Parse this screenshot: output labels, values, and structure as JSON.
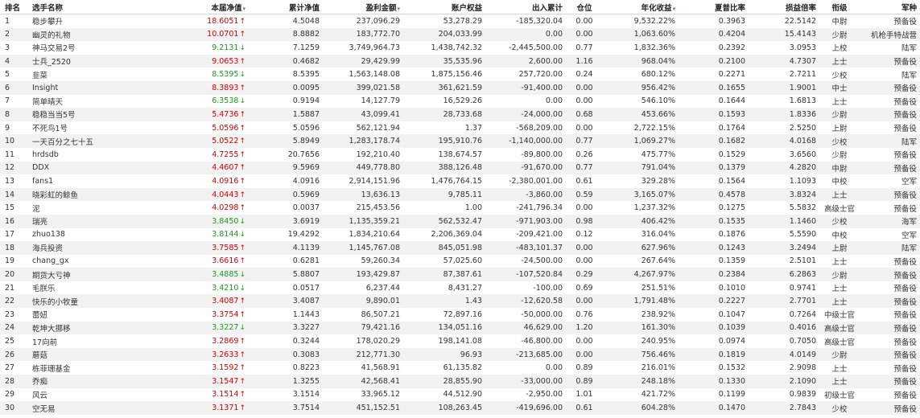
{
  "headers": {
    "rank": "排名",
    "name": "选手名称",
    "nav": "本届净值",
    "cum_nav": "累计净值",
    "profit": "盈利金额",
    "equity": "账户权益",
    "io": "出入累计",
    "position": "仓位",
    "annual": "年化收益",
    "sharpe": "夏普比率",
    "drawdown_mult": "损益倍率",
    "grade": "衔级",
    "army": "军种"
  },
  "sort_indicator": "▾",
  "colors": {
    "up": "#d40000",
    "down": "#1a9a1a"
  },
  "rows": [
    {
      "rank": "1",
      "name": "稳步攀升",
      "nav": "18.6051",
      "dir": "up",
      "cum_nav": "4.5048",
      "profit": "237,096.29",
      "equity": "53,278.29",
      "io": "-185,320.04",
      "position": "0.00",
      "annual": "9,532.22%",
      "sharpe": "0.3963",
      "ratio": "22.5142",
      "grade": "中尉",
      "army": "预备役"
    },
    {
      "rank": "2",
      "name": "幽灵的礼物",
      "nav": "10.0701",
      "dir": "up",
      "cum_nav": "8.8882",
      "profit": "183,772.70",
      "equity": "204,033.99",
      "io": "0.00",
      "position": "0.00",
      "annual": "1,063.60%",
      "sharpe": "0.4204",
      "ratio": "15.4143",
      "grade": "少尉",
      "army": "机枪手特战营"
    },
    {
      "rank": "3",
      "name": "神马交易2号",
      "nav": "9.2131",
      "dir": "down",
      "cum_nav": "7.1259",
      "profit": "3,749,964.73",
      "equity": "1,438,742.32",
      "io": "-2,445,500.00",
      "position": "0.77",
      "annual": "1,832.36%",
      "sharpe": "0.2392",
      "ratio": "3.0953",
      "grade": "上校",
      "army": "陆军"
    },
    {
      "rank": "4",
      "name": "士兵_2520",
      "nav": "9.0653",
      "dir": "up",
      "cum_nav": "0.4682",
      "profit": "29,429.99",
      "equity": "35,535.96",
      "io": "2,600.00",
      "position": "1.16",
      "annual": "968.04%",
      "sharpe": "0.2100",
      "ratio": "4.7307",
      "grade": "上士",
      "army": "预备役"
    },
    {
      "rank": "5",
      "name": "韭菜",
      "nav": "8.5395",
      "dir": "down",
      "cum_nav": "8.5395",
      "profit": "1,563,148.08",
      "equity": "1,875,156.46",
      "io": "257,720.00",
      "position": "0.24",
      "annual": "680.12%",
      "sharpe": "0.2271",
      "ratio": "2.7211",
      "grade": "少校",
      "army": "陆军"
    },
    {
      "rank": "6",
      "name": "Insight",
      "nav": "8.3893",
      "dir": "up",
      "cum_nav": "0.0095",
      "profit": "399,021.58",
      "equity": "361,621.59",
      "io": "-91,400.00",
      "position": "0.00",
      "annual": "956.42%",
      "sharpe": "0.1655",
      "ratio": "1.9001",
      "grade": "中士",
      "army": "预备役"
    },
    {
      "rank": "7",
      "name": "简单晴天",
      "nav": "6.3538",
      "dir": "down",
      "cum_nav": "0.9194",
      "profit": "14,127.79",
      "equity": "16,529.26",
      "io": "0.00",
      "position": "0.00",
      "annual": "546.10%",
      "sharpe": "0.1644",
      "ratio": "1.6813",
      "grade": "上士",
      "army": "预备役"
    },
    {
      "rank": "8",
      "name": "稳稳当当5号",
      "nav": "5.4736",
      "dir": "up",
      "cum_nav": "1.5887",
      "profit": "43,099.41",
      "equity": "28,733.68",
      "io": "-24,000.00",
      "position": "0.68",
      "annual": "453.66%",
      "sharpe": "0.1593",
      "ratio": "1.8336",
      "grade": "少尉",
      "army": "预备役"
    },
    {
      "rank": "9",
      "name": "不死鸟1号",
      "nav": "5.0596",
      "dir": "up",
      "cum_nav": "5.0596",
      "profit": "562,121.94",
      "equity": "1.37",
      "io": "-568,209.00",
      "position": "0.00",
      "annual": "2,722.15%",
      "sharpe": "0.1764",
      "ratio": "2.5250",
      "grade": "上尉",
      "army": "预备役"
    },
    {
      "rank": "10",
      "name": "一天百分之七十五",
      "nav": "5.0522",
      "dir": "up",
      "cum_nav": "5.8949",
      "profit": "1,283,178.74",
      "equity": "195,910.76",
      "io": "-1,140,000.00",
      "position": "0.77",
      "annual": "1,069.27%",
      "sharpe": "0.1682",
      "ratio": "4.0168",
      "grade": "少校",
      "army": "陆军"
    },
    {
      "rank": "11",
      "name": "hrdsdb",
      "nav": "4.7255",
      "dir": "up",
      "cum_nav": "20.7656",
      "profit": "192,210.40",
      "equity": "138,674.57",
      "io": "-89,800.00",
      "position": "0.26",
      "annual": "475.77%",
      "sharpe": "0.1529",
      "ratio": "3.6560",
      "grade": "少尉",
      "army": "预备役"
    },
    {
      "rank": "12",
      "name": "DDX",
      "nav": "4.4607",
      "dir": "up",
      "cum_nav": "9.5969",
      "profit": "449,778.80",
      "equity": "388,126.48",
      "io": "-91,670.00",
      "position": "0.77",
      "annual": "791.04%",
      "sharpe": "0.1379",
      "ratio": "4.2820",
      "grade": "中尉",
      "army": "预备役"
    },
    {
      "rank": "13",
      "name": "fans1",
      "nav": "4.0916",
      "dir": "up",
      "cum_nav": "4.0916",
      "profit": "2,914,151.96",
      "equity": "1,476,764.15",
      "io": "-2,380,001.00",
      "position": "0.61",
      "annual": "329.28%",
      "sharpe": "0.1564",
      "ratio": "1.1093",
      "grade": "中校",
      "army": "空军"
    },
    {
      "rank": "14",
      "name": "晓彩虹的鲸鱼",
      "nav": "4.0443",
      "dir": "up",
      "cum_nav": "0.5969",
      "profit": "13,636.13",
      "equity": "9,785.11",
      "io": "-3,860.00",
      "position": "0.59",
      "annual": "3,165.07%",
      "sharpe": "0.4578",
      "ratio": "3.8324",
      "grade": "上士",
      "army": "预备役"
    },
    {
      "rank": "15",
      "name": "泥",
      "nav": "4.0298",
      "dir": "up",
      "cum_nav": "0.0037",
      "profit": "215,453.56",
      "equity": "1.00",
      "io": "-241,796.34",
      "position": "0.00",
      "annual": "1,237.32%",
      "sharpe": "0.1275",
      "ratio": "5.5832",
      "grade": "高级士官",
      "army": "预备役"
    },
    {
      "rank": "16",
      "name": "瑞亮",
      "nav": "3.8450",
      "dir": "down",
      "cum_nav": "3.6919",
      "profit": "1,135,359.21",
      "equity": "562,532.47",
      "io": "-971,903.00",
      "position": "0.98",
      "annual": "406.42%",
      "sharpe": "0.1535",
      "ratio": "1.1460",
      "grade": "少校",
      "army": "海军"
    },
    {
      "rank": "17",
      "name": "zhuo138",
      "nav": "3.8144",
      "dir": "down",
      "cum_nav": "19.4292",
      "profit": "1,834,210.64",
      "equity": "2,206,369.04",
      "io": "-209,421.00",
      "position": "0.12",
      "annual": "316.04%",
      "sharpe": "0.1876",
      "ratio": "5.5590",
      "grade": "中校",
      "army": "空军"
    },
    {
      "rank": "18",
      "name": "海兵投资",
      "nav": "3.7585",
      "dir": "up",
      "cum_nav": "4.1139",
      "profit": "1,145,767.08",
      "equity": "845,051.98",
      "io": "-483,101.37",
      "position": "0.00",
      "annual": "627.96%",
      "sharpe": "0.1243",
      "ratio": "3.2494",
      "grade": "上尉",
      "army": "陆军"
    },
    {
      "rank": "19",
      "name": "chang_gx",
      "nav": "3.6616",
      "dir": "up",
      "cum_nav": "0.6281",
      "profit": "59,260.34",
      "equity": "57,025.60",
      "io": "-24,500.00",
      "position": "0.00",
      "annual": "267.64%",
      "sharpe": "0.1359",
      "ratio": "2.5101",
      "grade": "上士",
      "army": "预备役"
    },
    {
      "rank": "20",
      "name": "期货大亏神",
      "nav": "3.4885",
      "dir": "down",
      "cum_nav": "5.8807",
      "profit": "193,429.87",
      "equity": "87,387.61",
      "io": "-107,520.84",
      "position": "0.29",
      "annual": "4,267.97%",
      "sharpe": "0.2384",
      "ratio": "6.2863",
      "grade": "少尉",
      "army": "预备役"
    },
    {
      "rank": "21",
      "name": "毛朕乐",
      "nav": "3.4210",
      "dir": "down",
      "cum_nav": "0.0517",
      "profit": "6,237.44",
      "equity": "8,431.27",
      "io": "-100.00",
      "position": "0.69",
      "annual": "251.51%",
      "sharpe": "0.1010",
      "ratio": "0.9741",
      "grade": "上士",
      "army": "预备役"
    },
    {
      "rank": "22",
      "name": "快乐的小牧童",
      "nav": "3.4087",
      "dir": "up",
      "cum_nav": "3.4087",
      "profit": "9,890.01",
      "equity": "1.43",
      "io": "-12,620.58",
      "position": "0.00",
      "annual": "1,791.48%",
      "sharpe": "0.2227",
      "ratio": "2.7701",
      "grade": "上士",
      "army": "预备役"
    },
    {
      "rank": "23",
      "name": "蕾妞",
      "nav": "3.3754",
      "dir": "up",
      "cum_nav": "1.1443",
      "profit": "86,507.21",
      "equity": "72,897.16",
      "io": "-50,000.00",
      "position": "0.76",
      "annual": "238.92%",
      "sharpe": "0.1047",
      "ratio": "0.7264",
      "grade": "中级士官",
      "army": "预备役"
    },
    {
      "rank": "24",
      "name": "乾坤大挪移",
      "nav": "3.3227",
      "dir": "down",
      "cum_nav": "3.3227",
      "profit": "79,421.16",
      "equity": "134,051.16",
      "io": "46,629.00",
      "position": "1.20",
      "annual": "161.30%",
      "sharpe": "0.1039",
      "ratio": "0.4016",
      "grade": "高级士官",
      "army": "预备役"
    },
    {
      "rank": "25",
      "name": "17向前",
      "nav": "3.2869",
      "dir": "up",
      "cum_nav": "0.3244",
      "profit": "178,020.29",
      "equity": "198,141.08",
      "io": "-46,800.00",
      "position": "0.00",
      "annual": "240.95%",
      "sharpe": "0.0974",
      "ratio": "0.7050",
      "grade": "高级士官",
      "army": "预备役"
    },
    {
      "rank": "26",
      "name": "蘑菇",
      "nav": "3.2633",
      "dir": "up",
      "cum_nav": "0.3083",
      "profit": "212,771.30",
      "equity": "96.93",
      "io": "-213,685.00",
      "position": "0.00",
      "annual": "756.46%",
      "sharpe": "0.1819",
      "ratio": "4.0149",
      "grade": "少尉",
      "army": "预备役"
    },
    {
      "rank": "27",
      "name": "栋菲珊基金",
      "nav": "3.1592",
      "dir": "up",
      "cum_nav": "0.8223",
      "profit": "41,568.91",
      "equity": "61,135.82",
      "io": "0.00",
      "position": "0.89",
      "annual": "216.01%",
      "sharpe": "0.1532",
      "ratio": "2.9098",
      "grade": "上士",
      "army": "预备役"
    },
    {
      "rank": "28",
      "name": "乔痴",
      "nav": "3.1547",
      "dir": "up",
      "cum_nav": "1.3255",
      "profit": "42,568.41",
      "equity": "28,855.90",
      "io": "-33,000.00",
      "position": "0.89",
      "annual": "248.18%",
      "sharpe": "0.1330",
      "ratio": "2.1090",
      "grade": "上士",
      "army": "预备役"
    },
    {
      "rank": "29",
      "name": "风云",
      "nav": "3.1514",
      "dir": "up",
      "cum_nav": "3.1514",
      "profit": "33,965.12",
      "equity": "44,512.90",
      "io": "-2,950.00",
      "position": "1.01",
      "annual": "421.72%",
      "sharpe": "0.1199",
      "ratio": "0.9839",
      "grade": "初级士官",
      "army": "预备役"
    },
    {
      "rank": "30",
      "name": "空无易",
      "nav": "3.1371",
      "dir": "up",
      "cum_nav": "3.7514",
      "profit": "451,152.51",
      "equity": "108,263.45",
      "io": "-419,696.00",
      "position": "0.61",
      "annual": "604.28%",
      "sharpe": "0.1470",
      "ratio": "2.7843",
      "grade": "少校",
      "army": "预备役"
    }
  ]
}
